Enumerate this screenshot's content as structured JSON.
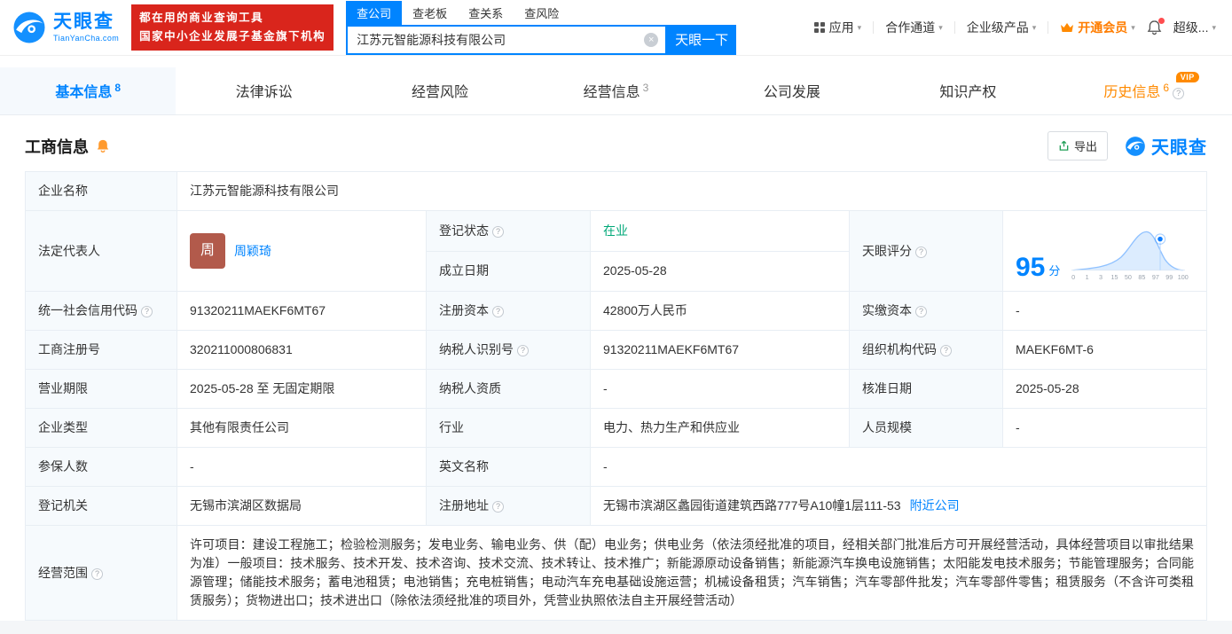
{
  "header": {
    "logo": {
      "brand": "天眼查",
      "domain": "TianYanCha.com"
    },
    "promo": {
      "line1": "都在用的商业查询工具",
      "line2": "国家中小企业发展子基金旗下机构"
    },
    "search": {
      "tabs": [
        {
          "label": "查公司",
          "active": true
        },
        {
          "label": "查老板",
          "active": false
        },
        {
          "label": "查关系",
          "active": false
        },
        {
          "label": "查风险",
          "active": false
        }
      ],
      "value": "江苏元智能源科技有限公司",
      "button": "天眼一下"
    },
    "nav": [
      {
        "label": "应用",
        "icon": "grid-icon"
      },
      {
        "label": "合作通道"
      },
      {
        "label": "企业级产品"
      },
      {
        "label": "开通会员",
        "icon": "crown-icon"
      },
      {
        "label": "超级..."
      }
    ]
  },
  "tabs": [
    {
      "label": "基本信息",
      "count": "8",
      "active": true
    },
    {
      "label": "法律诉讼",
      "count": ""
    },
    {
      "label": "经营风险",
      "count": ""
    },
    {
      "label": "经营信息",
      "count": "3"
    },
    {
      "label": "公司发展",
      "count": ""
    },
    {
      "label": "知识产权",
      "count": ""
    },
    {
      "label": "历史信息",
      "count": "6",
      "badge": "VIP"
    }
  ],
  "section": {
    "title": "工商信息",
    "export_label": "导出",
    "brand": "天眼查"
  },
  "info": {
    "labels": {
      "company_name": "企业名称",
      "legal_rep": "法定代表人",
      "reg_status": "登记状态",
      "est_date": "成立日期",
      "score": "天眼评分",
      "credit_code": "统一社会信用代码",
      "reg_capital": "注册资本",
      "paid_capital": "实缴资本",
      "reg_number": "工商注册号",
      "taxpayer_id": "纳税人识别号",
      "org_code": "组织机构代码",
      "business_term": "营业期限",
      "taxpayer_quality": "纳税人资质",
      "approval_date": "核准日期",
      "company_type": "企业类型",
      "industry": "行业",
      "staff_size": "人员规模",
      "insured_count": "参保人数",
      "english_name": "英文名称",
      "reg_authority": "登记机关",
      "reg_address": "注册地址",
      "business_scope": "经营范围"
    },
    "values": {
      "company_name": "江苏元智能源科技有限公司",
      "legal_rep": "周颖琦",
      "legal_rep_avatar": "周",
      "reg_status": "在业",
      "est_date": "2025-05-28",
      "score": "95",
      "score_unit": "分",
      "credit_code": "91320211MAEKF6MT67",
      "reg_capital": "42800万人民币",
      "paid_capital": "-",
      "reg_number": "320211000806831",
      "taxpayer_id": "91320211MAEKF6MT67",
      "org_code": "MAEKF6MT-6",
      "business_term": "2025-05-28 至 无固定期限",
      "taxpayer_quality": "-",
      "approval_date": "2025-05-28",
      "company_type": "其他有限责任公司",
      "industry": "电力、热力生产和供应业",
      "staff_size": "-",
      "insured_count": "-",
      "english_name": "-",
      "reg_authority": "无锡市滨湖区数据局",
      "reg_address": "无锡市滨湖区蠡园街道建筑西路777号A10幢1层111-53",
      "nearby_link": "附近公司",
      "business_scope": "许可项目：建设工程施工；检验检测服务；发电业务、输电业务、供（配）电业务；供电业务（依法须经批准的项目，经相关部门批准后方可开展经营活动，具体经营项目以审批结果为准）一般项目：技术服务、技术开发、技术咨询、技术交流、技术转让、技术推广；新能源原动设备销售；新能源汽车换电设施销售；太阳能发电技术服务；节能管理服务；合同能源管理；储能技术服务；蓄电池租赁；电池销售；充电桩销售；电动汽车充电基础设施运营；机械设备租赁；汽车销售；汽车零部件批发；汽车零部件零售；租赁服务（不含许可类租赁服务）；货物进出口；技术进出口（除依法须经批准的项目外，凭营业执照依法自主开展经营活动）"
    }
  },
  "chart_data": {
    "type": "area",
    "title": "天眼评分分布",
    "ticks": [
      "0",
      "1",
      "3",
      "15",
      "50",
      "85",
      "97",
      "99",
      "100"
    ],
    "score": 95,
    "marker_tick": "97"
  },
  "icons": {
    "caret": "▾",
    "clear": "×",
    "help": "?"
  },
  "colors": {
    "brand_blue": "#0084ff",
    "promo_red": "#d9251c",
    "vip_orange": "#ff8a00",
    "status_green": "#00a878",
    "label_cell_bg": "#f6fafd"
  }
}
